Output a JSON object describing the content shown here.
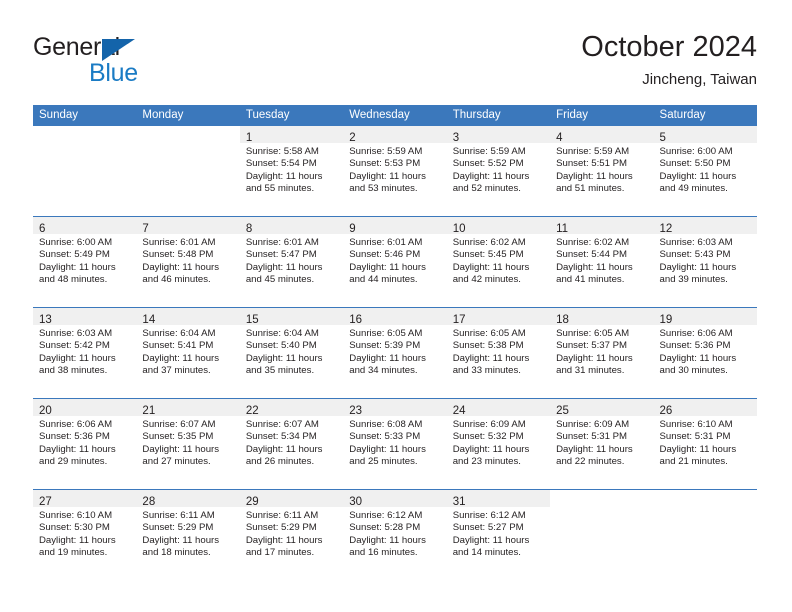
{
  "brand": {
    "name_top": "General",
    "name_bottom": "Blue",
    "triangle_color": "#1464aa",
    "blue_text_color": "#1a7bc4"
  },
  "header": {
    "title": "October 2024",
    "subtitle": "Jincheng, Taiwan"
  },
  "theme": {
    "header_blue": "#3b78bc",
    "daynum_strip": "#f0f0f0",
    "text": "#231f20",
    "page_background": "#ffffff"
  },
  "weekday_headers": [
    "Sunday",
    "Monday",
    "Tuesday",
    "Wednesday",
    "Thursday",
    "Friday",
    "Saturday"
  ],
  "weeks": [
    [
      {
        "day": "",
        "lines": [],
        "blank": true
      },
      {
        "day": "",
        "lines": [],
        "blank": true
      },
      {
        "day": "1",
        "lines": [
          "Sunrise: 5:58 AM",
          "Sunset: 5:54 PM",
          "Daylight: 11 hours",
          "and 55 minutes."
        ]
      },
      {
        "day": "2",
        "lines": [
          "Sunrise: 5:59 AM",
          "Sunset: 5:53 PM",
          "Daylight: 11 hours",
          "and 53 minutes."
        ]
      },
      {
        "day": "3",
        "lines": [
          "Sunrise: 5:59 AM",
          "Sunset: 5:52 PM",
          "Daylight: 11 hours",
          "and 52 minutes."
        ]
      },
      {
        "day": "4",
        "lines": [
          "Sunrise: 5:59 AM",
          "Sunset: 5:51 PM",
          "Daylight: 11 hours",
          "and 51 minutes."
        ]
      },
      {
        "day": "5",
        "lines": [
          "Sunrise: 6:00 AM",
          "Sunset: 5:50 PM",
          "Daylight: 11 hours",
          "and 49 minutes."
        ]
      }
    ],
    [
      {
        "day": "6",
        "lines": [
          "Sunrise: 6:00 AM",
          "Sunset: 5:49 PM",
          "Daylight: 11 hours",
          "and 48 minutes."
        ]
      },
      {
        "day": "7",
        "lines": [
          "Sunrise: 6:01 AM",
          "Sunset: 5:48 PM",
          "Daylight: 11 hours",
          "and 46 minutes."
        ]
      },
      {
        "day": "8",
        "lines": [
          "Sunrise: 6:01 AM",
          "Sunset: 5:47 PM",
          "Daylight: 11 hours",
          "and 45 minutes."
        ]
      },
      {
        "day": "9",
        "lines": [
          "Sunrise: 6:01 AM",
          "Sunset: 5:46 PM",
          "Daylight: 11 hours",
          "and 44 minutes."
        ]
      },
      {
        "day": "10",
        "lines": [
          "Sunrise: 6:02 AM",
          "Sunset: 5:45 PM",
          "Daylight: 11 hours",
          "and 42 minutes."
        ]
      },
      {
        "day": "11",
        "lines": [
          "Sunrise: 6:02 AM",
          "Sunset: 5:44 PM",
          "Daylight: 11 hours",
          "and 41 minutes."
        ]
      },
      {
        "day": "12",
        "lines": [
          "Sunrise: 6:03 AM",
          "Sunset: 5:43 PM",
          "Daylight: 11 hours",
          "and 39 minutes."
        ]
      }
    ],
    [
      {
        "day": "13",
        "lines": [
          "Sunrise: 6:03 AM",
          "Sunset: 5:42 PM",
          "Daylight: 11 hours",
          "and 38 minutes."
        ]
      },
      {
        "day": "14",
        "lines": [
          "Sunrise: 6:04 AM",
          "Sunset: 5:41 PM",
          "Daylight: 11 hours",
          "and 37 minutes."
        ]
      },
      {
        "day": "15",
        "lines": [
          "Sunrise: 6:04 AM",
          "Sunset: 5:40 PM",
          "Daylight: 11 hours",
          "and 35 minutes."
        ]
      },
      {
        "day": "16",
        "lines": [
          "Sunrise: 6:05 AM",
          "Sunset: 5:39 PM",
          "Daylight: 11 hours",
          "and 34 minutes."
        ]
      },
      {
        "day": "17",
        "lines": [
          "Sunrise: 6:05 AM",
          "Sunset: 5:38 PM",
          "Daylight: 11 hours",
          "and 33 minutes."
        ]
      },
      {
        "day": "18",
        "lines": [
          "Sunrise: 6:05 AM",
          "Sunset: 5:37 PM",
          "Daylight: 11 hours",
          "and 31 minutes."
        ]
      },
      {
        "day": "19",
        "lines": [
          "Sunrise: 6:06 AM",
          "Sunset: 5:36 PM",
          "Daylight: 11 hours",
          "and 30 minutes."
        ]
      }
    ],
    [
      {
        "day": "20",
        "lines": [
          "Sunrise: 6:06 AM",
          "Sunset: 5:36 PM",
          "Daylight: 11 hours",
          "and 29 minutes."
        ]
      },
      {
        "day": "21",
        "lines": [
          "Sunrise: 6:07 AM",
          "Sunset: 5:35 PM",
          "Daylight: 11 hours",
          "and 27 minutes."
        ]
      },
      {
        "day": "22",
        "lines": [
          "Sunrise: 6:07 AM",
          "Sunset: 5:34 PM",
          "Daylight: 11 hours",
          "and 26 minutes."
        ]
      },
      {
        "day": "23",
        "lines": [
          "Sunrise: 6:08 AM",
          "Sunset: 5:33 PM",
          "Daylight: 11 hours",
          "and 25 minutes."
        ]
      },
      {
        "day": "24",
        "lines": [
          "Sunrise: 6:09 AM",
          "Sunset: 5:32 PM",
          "Daylight: 11 hours",
          "and 23 minutes."
        ]
      },
      {
        "day": "25",
        "lines": [
          "Sunrise: 6:09 AM",
          "Sunset: 5:31 PM",
          "Daylight: 11 hours",
          "and 22 minutes."
        ]
      },
      {
        "day": "26",
        "lines": [
          "Sunrise: 6:10 AM",
          "Sunset: 5:31 PM",
          "Daylight: 11 hours",
          "and 21 minutes."
        ]
      }
    ],
    [
      {
        "day": "27",
        "lines": [
          "Sunrise: 6:10 AM",
          "Sunset: 5:30 PM",
          "Daylight: 11 hours",
          "and 19 minutes."
        ]
      },
      {
        "day": "28",
        "lines": [
          "Sunrise: 6:11 AM",
          "Sunset: 5:29 PM",
          "Daylight: 11 hours",
          "and 18 minutes."
        ]
      },
      {
        "day": "29",
        "lines": [
          "Sunrise: 6:11 AM",
          "Sunset: 5:29 PM",
          "Daylight: 11 hours",
          "and 17 minutes."
        ]
      },
      {
        "day": "30",
        "lines": [
          "Sunrise: 6:12 AM",
          "Sunset: 5:28 PM",
          "Daylight: 11 hours",
          "and 16 minutes."
        ]
      },
      {
        "day": "31",
        "lines": [
          "Sunrise: 6:12 AM",
          "Sunset: 5:27 PM",
          "Daylight: 11 hours",
          "and 14 minutes."
        ]
      },
      {
        "day": "",
        "lines": [],
        "blank": true
      },
      {
        "day": "",
        "lines": [],
        "blank": true
      }
    ]
  ]
}
